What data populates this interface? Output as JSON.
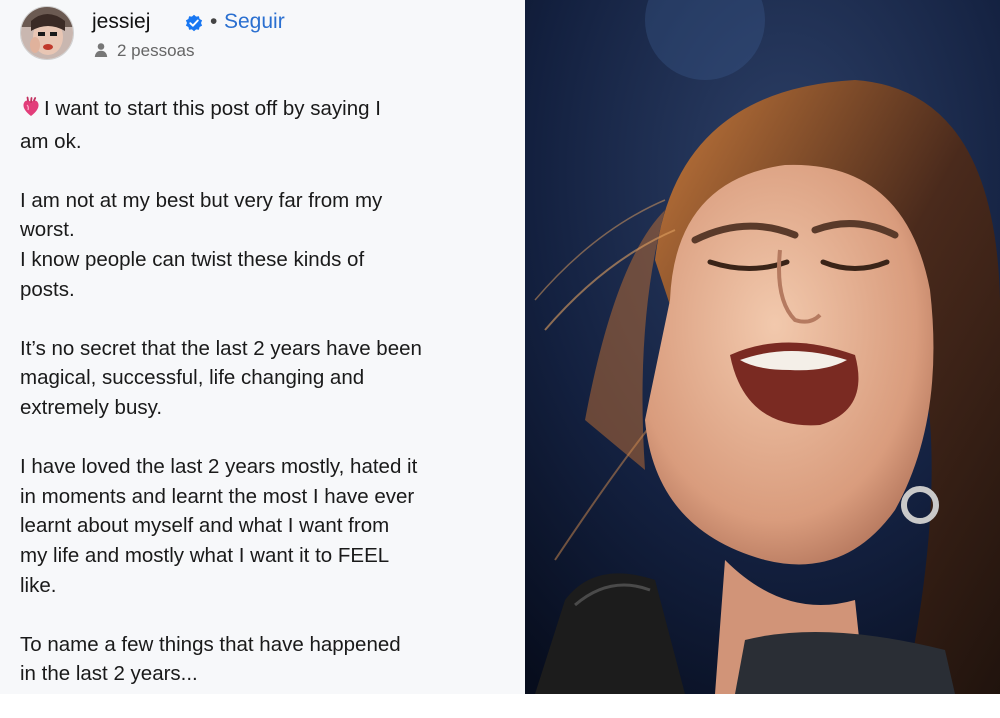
{
  "author": {
    "username": "jessiej",
    "separator": "•",
    "follow_label": "Seguir",
    "people_text": "2 pessoas"
  },
  "post": {
    "paragraphs": [
      [
        "I want to start this post off by saying I",
        "am ok."
      ],
      [
        "I am not at my best but very far from my",
        "worst.",
        "I know people can twist these kinds of",
        "posts."
      ],
      [
        "It’s no secret that the last 2 years have been",
        "magical, successful, life changing and",
        "extremely busy."
      ],
      [
        "I have loved the last 2 years mostly, hated it",
        "in moments and learnt the most I have ever",
        "learnt about myself and what I want from",
        "my life and mostly what I want it to FEEL",
        "like."
      ],
      [
        "To name a few things that have happened",
        "in the last 2 years..."
      ]
    ]
  },
  "icons": {
    "heart": "anatomical-heart-icon",
    "verified": "verified-badge-icon",
    "people": "people-icon"
  },
  "colors": {
    "link": "#2a6fd0",
    "verified": "#1877f2",
    "panel_bg": "#f7f8fa"
  }
}
